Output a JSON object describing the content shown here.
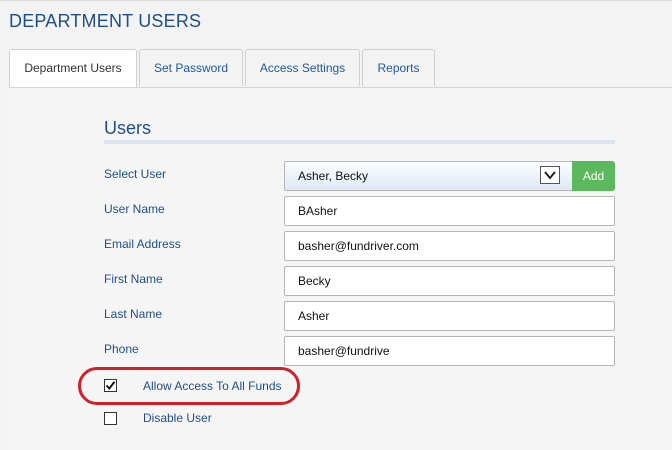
{
  "page": {
    "title": "DEPARTMENT USERS"
  },
  "tabs": [
    {
      "label": "Department Users",
      "active": true
    },
    {
      "label": "Set Password",
      "active": false
    },
    {
      "label": "Access Settings",
      "active": false
    },
    {
      "label": "Reports",
      "active": false
    }
  ],
  "section": {
    "title": "Users"
  },
  "form": {
    "select_user": {
      "label": "Select User",
      "value": "Asher, Becky",
      "add_label": "Add"
    },
    "user_name": {
      "label": "User Name",
      "value": "BAsher"
    },
    "email": {
      "label": "Email Address",
      "value": "basher@fundriver.com"
    },
    "first_name": {
      "label": "First Name",
      "value": "Becky"
    },
    "last_name": {
      "label": "Last Name",
      "value": "Asher"
    },
    "phone": {
      "label": "Phone",
      "value": "basher@fundrive"
    },
    "allow_all_funds": {
      "label": "Allow Access To All Funds",
      "checked": true
    },
    "disable_user": {
      "label": "Disable User",
      "checked": false
    }
  },
  "icons": {
    "select_arrow": "chevron-down-icon",
    "checkmark": "checkmark-icon"
  },
  "colors": {
    "heading": "#1f4e8c",
    "link": "#1f5aa6",
    "add_button": "#5cb85c",
    "annotation": "#d0202a"
  }
}
